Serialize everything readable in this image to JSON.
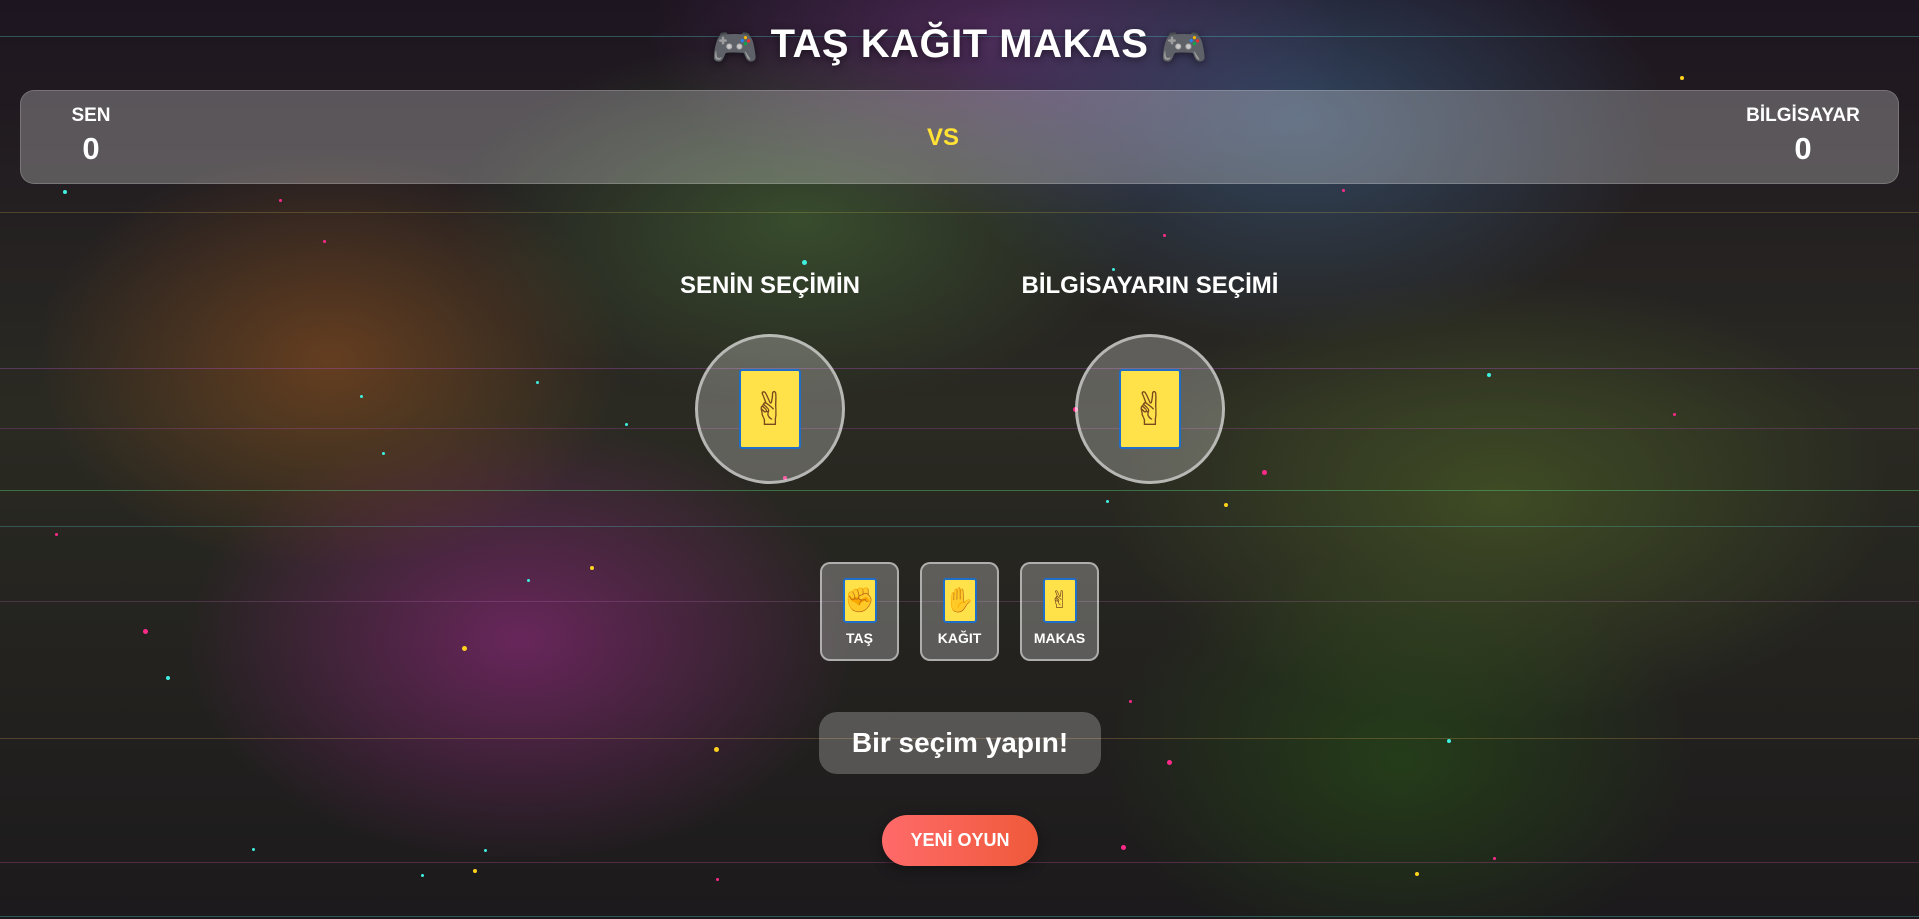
{
  "title": {
    "text": "TAŞ KAĞIT MAKAS",
    "icon": "game-controller-icon"
  },
  "scoreboard": {
    "player_name": "SEN",
    "player_score": "0",
    "vs": "VS",
    "computer_name": "BİLGİSAYAR",
    "computer_score": "0"
  },
  "arena": {
    "player_label": "SENİN SEÇİMİN",
    "computer_label": "BİLGİSAYARIN SEÇİMİ",
    "player_choice_icon": "scissors-hand-icon",
    "computer_choice_icon": "scissors-hand-icon"
  },
  "choices": [
    {
      "label": "TAŞ",
      "icon": "rock-hand-icon"
    },
    {
      "label": "KAĞIT",
      "icon": "paper-hand-icon"
    },
    {
      "label": "MAKAS",
      "icon": "scissors-hand-icon"
    }
  ],
  "message": "Bir seçim yapın!",
  "new_game_label": "YENİ OYUN",
  "colors": {
    "vs": "#ffe234",
    "card_fill": "#ffe14a",
    "card_border": "#1f6fc8",
    "new_game_button": "#ff6a6a"
  }
}
